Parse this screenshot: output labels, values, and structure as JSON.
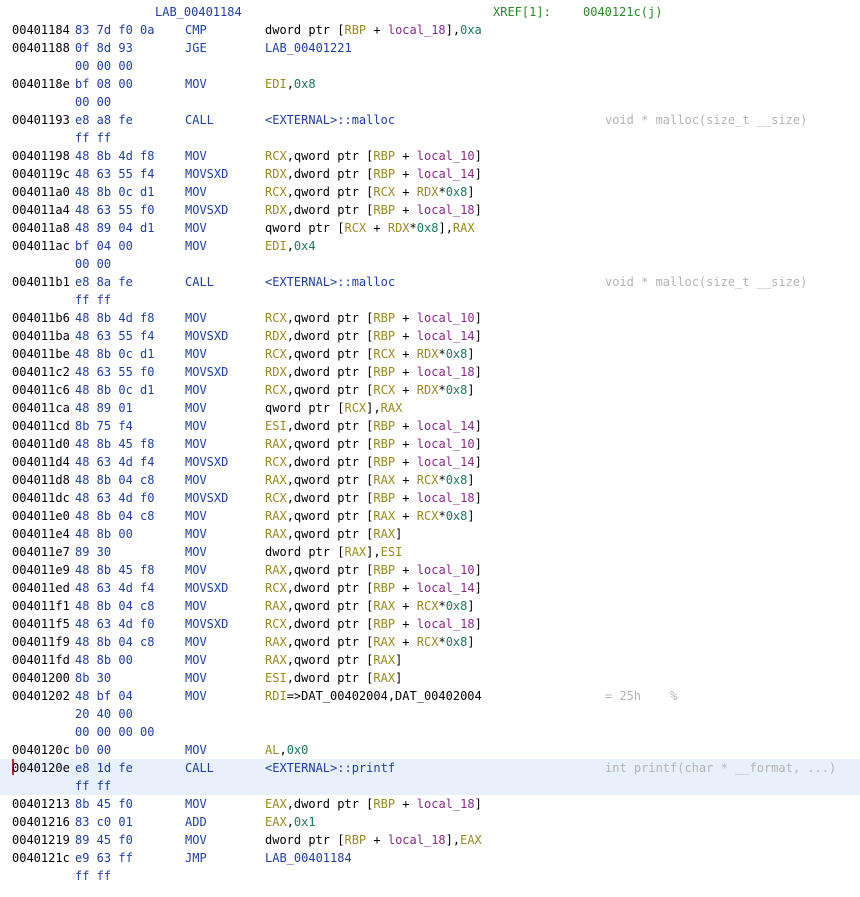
{
  "colors": {
    "background": "#ffffff",
    "address": "#000000",
    "bytes": "#1e3ea8",
    "mnemonic": "#1e3ea8",
    "label": "#1e3ea8",
    "register": "#9a8a20",
    "local_var": "#8a2a8a",
    "constant": "#1a7a5a",
    "xref": "#2a8a2a",
    "comment": "#b4b4b4",
    "selection": "#e8f0fb",
    "cursor": "#d02020"
  },
  "header": {
    "label": "LAB_00401184",
    "xref_label": "XREF[1]:",
    "xref_addr": "0040121c(j)"
  },
  "rows": [
    {
      "addr": "00401184",
      "bytes": "83 7d f0 0a",
      "mn": "CMP",
      "ops": [
        {
          "t": "dword ptr [",
          "c": "plain"
        },
        {
          "t": "RBP",
          "c": "reg"
        },
        {
          "t": " + ",
          "c": "plain"
        },
        {
          "t": "local_18",
          "c": "var"
        },
        {
          "t": "],",
          "c": "plain"
        },
        {
          "t": "0xa",
          "c": "num"
        }
      ]
    },
    {
      "addr": "00401188",
      "bytes": "0f 8d 93",
      "mn": "JGE",
      "ops": [
        {
          "t": "LAB_00401221",
          "c": "lbl"
        }
      ]
    },
    {
      "bytes": "00 00 00"
    },
    {
      "addr": "0040118e",
      "bytes": "bf 08 00",
      "mn": "MOV",
      "ops": [
        {
          "t": "EDI",
          "c": "reg"
        },
        {
          "t": ",",
          "c": "plain"
        },
        {
          "t": "0x8",
          "c": "num"
        }
      ]
    },
    {
      "bytes": "00 00"
    },
    {
      "addr": "00401193",
      "bytes": "e8 a8 fe",
      "mn": "CALL",
      "ops": [
        {
          "t": "<EXTERNAL>::malloc",
          "c": "lbl"
        }
      ],
      "cmt": "void * malloc(size_t __size)"
    },
    {
      "bytes": "ff ff"
    },
    {
      "addr": "00401198",
      "bytes": "48 8b 4d f8",
      "mn": "MOV",
      "ops": [
        {
          "t": "RCX",
          "c": "reg"
        },
        {
          "t": ",qword ptr [",
          "c": "plain"
        },
        {
          "t": "RBP",
          "c": "reg"
        },
        {
          "t": " + ",
          "c": "plain"
        },
        {
          "t": "local_10",
          "c": "var"
        },
        {
          "t": "]",
          "c": "plain"
        }
      ]
    },
    {
      "addr": "0040119c",
      "bytes": "48 63 55 f4",
      "mn": "MOVSXD",
      "ops": [
        {
          "t": "RDX",
          "c": "reg"
        },
        {
          "t": ",dword ptr [",
          "c": "plain"
        },
        {
          "t": "RBP",
          "c": "reg"
        },
        {
          "t": " + ",
          "c": "plain"
        },
        {
          "t": "local_14",
          "c": "var"
        },
        {
          "t": "]",
          "c": "plain"
        }
      ]
    },
    {
      "addr": "004011a0",
      "bytes": "48 8b 0c d1",
      "mn": "MOV",
      "ops": [
        {
          "t": "RCX",
          "c": "reg"
        },
        {
          "t": ",qword ptr [",
          "c": "plain"
        },
        {
          "t": "RCX",
          "c": "reg"
        },
        {
          "t": " + ",
          "c": "plain"
        },
        {
          "t": "RDX",
          "c": "reg"
        },
        {
          "t": "*",
          "c": "plain"
        },
        {
          "t": "0x8",
          "c": "num"
        },
        {
          "t": "]",
          "c": "plain"
        }
      ]
    },
    {
      "addr": "004011a4",
      "bytes": "48 63 55 f0",
      "mn": "MOVSXD",
      "ops": [
        {
          "t": "RDX",
          "c": "reg"
        },
        {
          "t": ",dword ptr [",
          "c": "plain"
        },
        {
          "t": "RBP",
          "c": "reg"
        },
        {
          "t": " + ",
          "c": "plain"
        },
        {
          "t": "local_18",
          "c": "var"
        },
        {
          "t": "]",
          "c": "plain"
        }
      ]
    },
    {
      "addr": "004011a8",
      "bytes": "48 89 04 d1",
      "mn": "MOV",
      "ops": [
        {
          "t": "qword ptr [",
          "c": "plain"
        },
        {
          "t": "RCX",
          "c": "reg"
        },
        {
          "t": " + ",
          "c": "plain"
        },
        {
          "t": "RDX",
          "c": "reg"
        },
        {
          "t": "*",
          "c": "plain"
        },
        {
          "t": "0x8",
          "c": "num"
        },
        {
          "t": "],",
          "c": "plain"
        },
        {
          "t": "RAX",
          "c": "reg"
        }
      ]
    },
    {
      "addr": "004011ac",
      "bytes": "bf 04 00",
      "mn": "MOV",
      "ops": [
        {
          "t": "EDI",
          "c": "reg"
        },
        {
          "t": ",",
          "c": "plain"
        },
        {
          "t": "0x4",
          "c": "num"
        }
      ]
    },
    {
      "bytes": "00 00"
    },
    {
      "addr": "004011b1",
      "bytes": "e8 8a fe",
      "mn": "CALL",
      "ops": [
        {
          "t": "<EXTERNAL>::malloc",
          "c": "lbl"
        }
      ],
      "cmt": "void * malloc(size_t __size)"
    },
    {
      "bytes": "ff ff"
    },
    {
      "addr": "004011b6",
      "bytes": "48 8b 4d f8",
      "mn": "MOV",
      "ops": [
        {
          "t": "RCX",
          "c": "reg"
        },
        {
          "t": ",qword ptr [",
          "c": "plain"
        },
        {
          "t": "RBP",
          "c": "reg"
        },
        {
          "t": " + ",
          "c": "plain"
        },
        {
          "t": "local_10",
          "c": "var"
        },
        {
          "t": "]",
          "c": "plain"
        }
      ]
    },
    {
      "addr": "004011ba",
      "bytes": "48 63 55 f4",
      "mn": "MOVSXD",
      "ops": [
        {
          "t": "RDX",
          "c": "reg"
        },
        {
          "t": ",dword ptr [",
          "c": "plain"
        },
        {
          "t": "RBP",
          "c": "reg"
        },
        {
          "t": " + ",
          "c": "plain"
        },
        {
          "t": "local_14",
          "c": "var"
        },
        {
          "t": "]",
          "c": "plain"
        }
      ]
    },
    {
      "addr": "004011be",
      "bytes": "48 8b 0c d1",
      "mn": "MOV",
      "ops": [
        {
          "t": "RCX",
          "c": "reg"
        },
        {
          "t": ",qword ptr [",
          "c": "plain"
        },
        {
          "t": "RCX",
          "c": "reg"
        },
        {
          "t": " + ",
          "c": "plain"
        },
        {
          "t": "RDX",
          "c": "reg"
        },
        {
          "t": "*",
          "c": "plain"
        },
        {
          "t": "0x8",
          "c": "num"
        },
        {
          "t": "]",
          "c": "plain"
        }
      ]
    },
    {
      "addr": "004011c2",
      "bytes": "48 63 55 f0",
      "mn": "MOVSXD",
      "ops": [
        {
          "t": "RDX",
          "c": "reg"
        },
        {
          "t": ",dword ptr [",
          "c": "plain"
        },
        {
          "t": "RBP",
          "c": "reg"
        },
        {
          "t": " + ",
          "c": "plain"
        },
        {
          "t": "local_18",
          "c": "var"
        },
        {
          "t": "]",
          "c": "plain"
        }
      ]
    },
    {
      "addr": "004011c6",
      "bytes": "48 8b 0c d1",
      "mn": "MOV",
      "ops": [
        {
          "t": "RCX",
          "c": "reg"
        },
        {
          "t": ",qword ptr [",
          "c": "plain"
        },
        {
          "t": "RCX",
          "c": "reg"
        },
        {
          "t": " + ",
          "c": "plain"
        },
        {
          "t": "RDX",
          "c": "reg"
        },
        {
          "t": "*",
          "c": "plain"
        },
        {
          "t": "0x8",
          "c": "num"
        },
        {
          "t": "]",
          "c": "plain"
        }
      ]
    },
    {
      "addr": "004011ca",
      "bytes": "48 89 01",
      "mn": "MOV",
      "ops": [
        {
          "t": "qword ptr [",
          "c": "plain"
        },
        {
          "t": "RCX",
          "c": "reg"
        },
        {
          "t": "],",
          "c": "plain"
        },
        {
          "t": "RAX",
          "c": "reg"
        }
      ]
    },
    {
      "addr": "004011cd",
      "bytes": "8b 75 f4",
      "mn": "MOV",
      "ops": [
        {
          "t": "ESI",
          "c": "reg"
        },
        {
          "t": ",dword ptr [",
          "c": "plain"
        },
        {
          "t": "RBP",
          "c": "reg"
        },
        {
          "t": " + ",
          "c": "plain"
        },
        {
          "t": "local_14",
          "c": "var"
        },
        {
          "t": "]",
          "c": "plain"
        }
      ]
    },
    {
      "addr": "004011d0",
      "bytes": "48 8b 45 f8",
      "mn": "MOV",
      "ops": [
        {
          "t": "RAX",
          "c": "reg"
        },
        {
          "t": ",qword ptr [",
          "c": "plain"
        },
        {
          "t": "RBP",
          "c": "reg"
        },
        {
          "t": " + ",
          "c": "plain"
        },
        {
          "t": "local_10",
          "c": "var"
        },
        {
          "t": "]",
          "c": "plain"
        }
      ]
    },
    {
      "addr": "004011d4",
      "bytes": "48 63 4d f4",
      "mn": "MOVSXD",
      "ops": [
        {
          "t": "RCX",
          "c": "reg"
        },
        {
          "t": ",dword ptr [",
          "c": "plain"
        },
        {
          "t": "RBP",
          "c": "reg"
        },
        {
          "t": " + ",
          "c": "plain"
        },
        {
          "t": "local_14",
          "c": "var"
        },
        {
          "t": "]",
          "c": "plain"
        }
      ]
    },
    {
      "addr": "004011d8",
      "bytes": "48 8b 04 c8",
      "mn": "MOV",
      "ops": [
        {
          "t": "RAX",
          "c": "reg"
        },
        {
          "t": ",qword ptr [",
          "c": "plain"
        },
        {
          "t": "RAX",
          "c": "reg"
        },
        {
          "t": " + ",
          "c": "plain"
        },
        {
          "t": "RCX",
          "c": "reg"
        },
        {
          "t": "*",
          "c": "plain"
        },
        {
          "t": "0x8",
          "c": "num"
        },
        {
          "t": "]",
          "c": "plain"
        }
      ]
    },
    {
      "addr": "004011dc",
      "bytes": "48 63 4d f0",
      "mn": "MOVSXD",
      "ops": [
        {
          "t": "RCX",
          "c": "reg"
        },
        {
          "t": ",dword ptr [",
          "c": "plain"
        },
        {
          "t": "RBP",
          "c": "reg"
        },
        {
          "t": " + ",
          "c": "plain"
        },
        {
          "t": "local_18",
          "c": "var"
        },
        {
          "t": "]",
          "c": "plain"
        }
      ]
    },
    {
      "addr": "004011e0",
      "bytes": "48 8b 04 c8",
      "mn": "MOV",
      "ops": [
        {
          "t": "RAX",
          "c": "reg"
        },
        {
          "t": ",qword ptr [",
          "c": "plain"
        },
        {
          "t": "RAX",
          "c": "reg"
        },
        {
          "t": " + ",
          "c": "plain"
        },
        {
          "t": "RCX",
          "c": "reg"
        },
        {
          "t": "*",
          "c": "plain"
        },
        {
          "t": "0x8",
          "c": "num"
        },
        {
          "t": "]",
          "c": "plain"
        }
      ]
    },
    {
      "addr": "004011e4",
      "bytes": "48 8b 00",
      "mn": "MOV",
      "ops": [
        {
          "t": "RAX",
          "c": "reg"
        },
        {
          "t": ",qword ptr [",
          "c": "plain"
        },
        {
          "t": "RAX",
          "c": "reg"
        },
        {
          "t": "]",
          "c": "plain"
        }
      ]
    },
    {
      "addr": "004011e7",
      "bytes": "89 30",
      "mn": "MOV",
      "ops": [
        {
          "t": "dword ptr [",
          "c": "plain"
        },
        {
          "t": "RAX",
          "c": "reg"
        },
        {
          "t": "],",
          "c": "plain"
        },
        {
          "t": "ESI",
          "c": "reg"
        }
      ]
    },
    {
      "addr": "004011e9",
      "bytes": "48 8b 45 f8",
      "mn": "MOV",
      "ops": [
        {
          "t": "RAX",
          "c": "reg"
        },
        {
          "t": ",qword ptr [",
          "c": "plain"
        },
        {
          "t": "RBP",
          "c": "reg"
        },
        {
          "t": " + ",
          "c": "plain"
        },
        {
          "t": "local_10",
          "c": "var"
        },
        {
          "t": "]",
          "c": "plain"
        }
      ]
    },
    {
      "addr": "004011ed",
      "bytes": "48 63 4d f4",
      "mn": "MOVSXD",
      "ops": [
        {
          "t": "RCX",
          "c": "reg"
        },
        {
          "t": ",dword ptr [",
          "c": "plain"
        },
        {
          "t": "RBP",
          "c": "reg"
        },
        {
          "t": " + ",
          "c": "plain"
        },
        {
          "t": "local_14",
          "c": "var"
        },
        {
          "t": "]",
          "c": "plain"
        }
      ]
    },
    {
      "addr": "004011f1",
      "bytes": "48 8b 04 c8",
      "mn": "MOV",
      "ops": [
        {
          "t": "RAX",
          "c": "reg"
        },
        {
          "t": ",qword ptr [",
          "c": "plain"
        },
        {
          "t": "RAX",
          "c": "reg"
        },
        {
          "t": " + ",
          "c": "plain"
        },
        {
          "t": "RCX",
          "c": "reg"
        },
        {
          "t": "*",
          "c": "plain"
        },
        {
          "t": "0x8",
          "c": "num"
        },
        {
          "t": "]",
          "c": "plain"
        }
      ]
    },
    {
      "addr": "004011f5",
      "bytes": "48 63 4d f0",
      "mn": "MOVSXD",
      "ops": [
        {
          "t": "RCX",
          "c": "reg"
        },
        {
          "t": ",dword ptr [",
          "c": "plain"
        },
        {
          "t": "RBP",
          "c": "reg"
        },
        {
          "t": " + ",
          "c": "plain"
        },
        {
          "t": "local_18",
          "c": "var"
        },
        {
          "t": "]",
          "c": "plain"
        }
      ]
    },
    {
      "addr": "004011f9",
      "bytes": "48 8b 04 c8",
      "mn": "MOV",
      "ops": [
        {
          "t": "RAX",
          "c": "reg"
        },
        {
          "t": ",qword ptr [",
          "c": "plain"
        },
        {
          "t": "RAX",
          "c": "reg"
        },
        {
          "t": " + ",
          "c": "plain"
        },
        {
          "t": "RCX",
          "c": "reg"
        },
        {
          "t": "*",
          "c": "plain"
        },
        {
          "t": "0x8",
          "c": "num"
        },
        {
          "t": "]",
          "c": "plain"
        }
      ]
    },
    {
      "addr": "004011fd",
      "bytes": "48 8b 00",
      "mn": "MOV",
      "ops": [
        {
          "t": "RAX",
          "c": "reg"
        },
        {
          "t": ",qword ptr [",
          "c": "plain"
        },
        {
          "t": "RAX",
          "c": "reg"
        },
        {
          "t": "]",
          "c": "plain"
        }
      ]
    },
    {
      "addr": "00401200",
      "bytes": "8b 30",
      "mn": "MOV",
      "ops": [
        {
          "t": "ESI",
          "c": "reg"
        },
        {
          "t": ",dword ptr [",
          "c": "plain"
        },
        {
          "t": "RAX",
          "c": "reg"
        },
        {
          "t": "]",
          "c": "plain"
        }
      ]
    },
    {
      "addr": "00401202",
      "bytes": "48 bf 04",
      "mn": "MOV",
      "ops": [
        {
          "t": "RDI",
          "c": "reg"
        },
        {
          "t": "=>DAT_00402004,DAT_00402004",
          "c": "plain"
        }
      ],
      "cmt": "= 25h    %"
    },
    {
      "bytes": "20 40 00"
    },
    {
      "bytes": "00 00 00 00"
    },
    {
      "addr": "0040120c",
      "bytes": "b0 00",
      "mn": "MOV",
      "ops": [
        {
          "t": "AL",
          "c": "reg"
        },
        {
          "t": ",",
          "c": "plain"
        },
        {
          "t": "0x0",
          "c": "num"
        }
      ]
    },
    {
      "addr": "0040120e",
      "bytes": "e8 1d fe",
      "mn": "CALL",
      "ops": [
        {
          "t": "<EXTERNAL>::printf",
          "c": "lbl"
        }
      ],
      "cmt": "int printf(char * __format, ...)",
      "selected": true,
      "cursor": true
    },
    {
      "bytes": "ff ff",
      "selected": true
    },
    {
      "addr": "00401213",
      "bytes": "8b 45 f0",
      "mn": "MOV",
      "ops": [
        {
          "t": "EAX",
          "c": "reg"
        },
        {
          "t": ",dword ptr [",
          "c": "plain"
        },
        {
          "t": "RBP",
          "c": "reg"
        },
        {
          "t": " + ",
          "c": "plain"
        },
        {
          "t": "local_18",
          "c": "var"
        },
        {
          "t": "]",
          "c": "plain"
        }
      ]
    },
    {
      "addr": "00401216",
      "bytes": "83 c0 01",
      "mn": "ADD",
      "ops": [
        {
          "t": "EAX",
          "c": "reg"
        },
        {
          "t": ",",
          "c": "plain"
        },
        {
          "t": "0x1",
          "c": "num"
        }
      ]
    },
    {
      "addr": "00401219",
      "bytes": "89 45 f0",
      "mn": "MOV",
      "ops": [
        {
          "t": "dword ptr [",
          "c": "plain"
        },
        {
          "t": "RBP",
          "c": "reg"
        },
        {
          "t": " + ",
          "c": "plain"
        },
        {
          "t": "local_18",
          "c": "var"
        },
        {
          "t": "],",
          "c": "plain"
        },
        {
          "t": "EAX",
          "c": "reg"
        }
      ]
    },
    {
      "addr": "0040121c",
      "bytes": "e9 63 ff",
      "mn": "JMP",
      "ops": [
        {
          "t": "LAB_00401184",
          "c": "lbl"
        }
      ]
    },
    {
      "bytes": "ff ff"
    }
  ]
}
